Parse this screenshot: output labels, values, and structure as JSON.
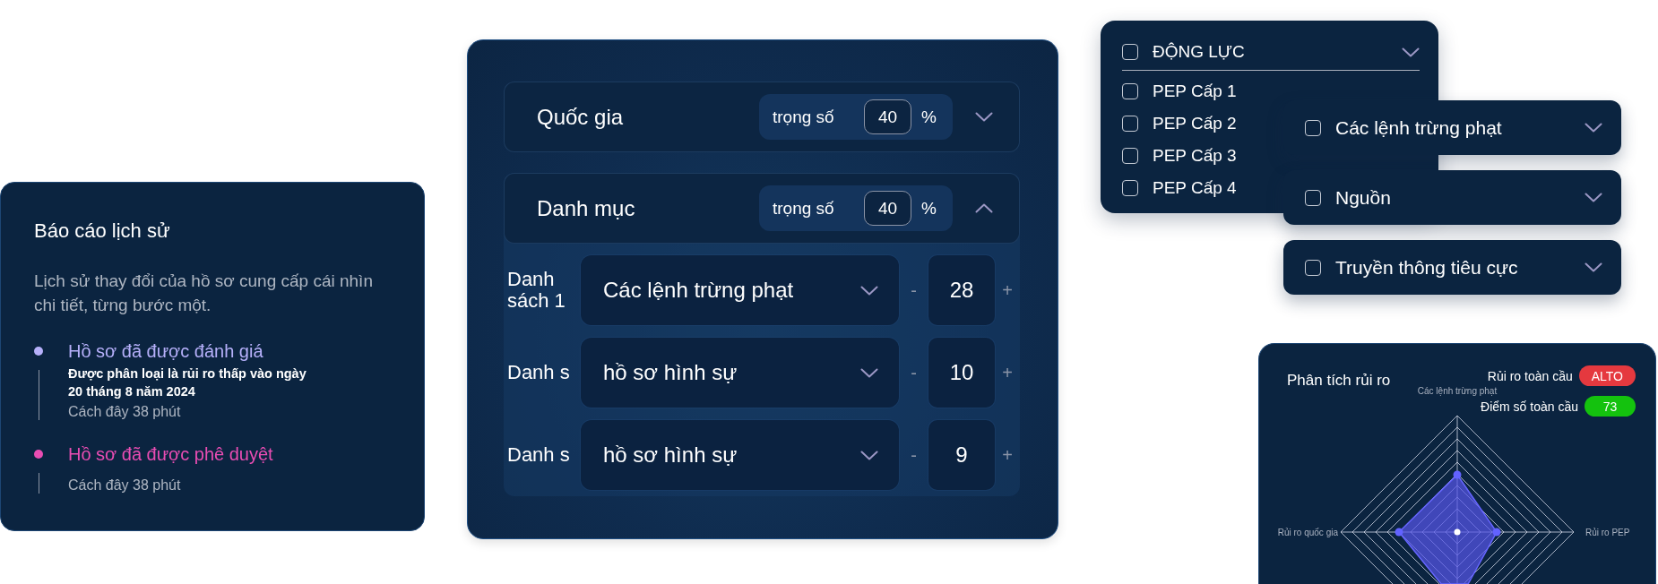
{
  "history_card": {
    "title": "Báo cáo lịch sử",
    "description": "Lịch sử thay đổi của hồ sơ cung cấp cái nhìn chi tiết, từng bước một.",
    "events": [
      {
        "title": "Hồ sơ đã được đánh giá",
        "color": "#b6b0fa",
        "detail": "Được phân loại là rủi ro thấp vào ngày 20 tháng 8 năm 2024",
        "time": "Cách đây 38 phút"
      },
      {
        "title": "Hồ sơ đã được phê duyệt",
        "color": "#e94db3",
        "time": "Cách đây 38 phút"
      }
    ]
  },
  "weights_card": {
    "sections": [
      {
        "label": "Quốc gia",
        "weight_label": "trọng số",
        "weight": "40",
        "unit": "%",
        "expanded": false
      },
      {
        "label": "Danh mục",
        "weight_label": "trọng số",
        "weight": "40",
        "unit": "%",
        "expanded": true,
        "lists": [
          {
            "label": "Danh sách 1",
            "value": "Các lệnh trừng phạt",
            "decrement": "-",
            "count": "28",
            "increment": "+"
          },
          {
            "label": "Danh s",
            "value": "hồ sơ hình sự",
            "decrement": "-",
            "count": "10",
            "increment": "+"
          },
          {
            "label": "Danh s",
            "value": "hồ sơ hình sự",
            "decrement": "-",
            "count": "9",
            "increment": "+"
          }
        ]
      }
    ]
  },
  "motive_dropdown": {
    "header": {
      "label": "ĐỘNG LỰC",
      "checked": false
    },
    "options": [
      {
        "label": "PEP Cấp 1",
        "checked": false
      },
      {
        "label": "PEP Cấp 2",
        "checked": false
      },
      {
        "label": "PEP Cấp 3",
        "checked": false
      },
      {
        "label": "PEP Cấp 4",
        "checked": false
      }
    ]
  },
  "filters": [
    {
      "label": "Các lệnh trừng phạt",
      "checked": false
    },
    {
      "label": "Nguồn",
      "checked": false
    },
    {
      "label": "Truyền thông tiêu cực",
      "checked": false
    }
  ],
  "risk_card": {
    "title": "Phân tích rủi ro",
    "indicators": [
      {
        "label": "Rủi ro toàn cầu",
        "value": "ALTO",
        "color": "#e5393f"
      },
      {
        "label": "Điểm số toàn cầu",
        "value": "73",
        "color": "#14c20e"
      }
    ],
    "axis_labels": [
      {
        "kind": "top",
        "label": "Các lệnh trừng phạt"
      },
      {
        "kind": "left",
        "label": "Rủi ro quốc gia"
      },
      {
        "kind": "right",
        "label": "Rủi ro PEP"
      }
    ]
  }
}
